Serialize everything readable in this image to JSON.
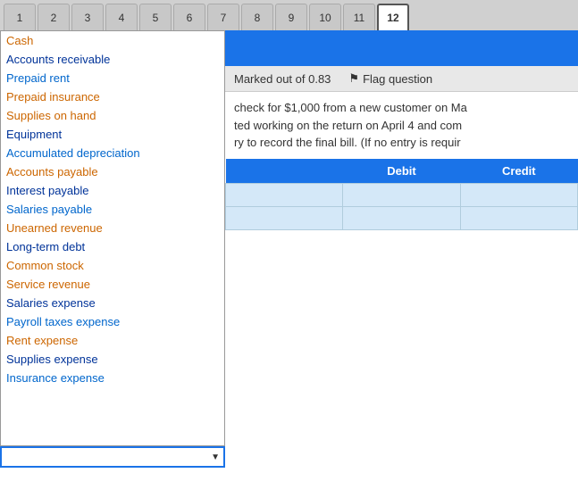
{
  "tabs": [
    {
      "label": "1"
    },
    {
      "label": "2"
    },
    {
      "label": "3"
    },
    {
      "label": "4"
    },
    {
      "label": "5"
    },
    {
      "label": "6"
    },
    {
      "label": "7"
    },
    {
      "label": "8"
    },
    {
      "label": "9"
    },
    {
      "label": "10"
    },
    {
      "label": "11"
    },
    {
      "label": "12"
    }
  ],
  "active_tab": "12",
  "dropdown": {
    "items": [
      {
        "label": "Cash",
        "color": "orange",
        "selected": false
      },
      {
        "label": "Accounts receivable",
        "color": "blue-dark",
        "selected": false
      },
      {
        "label": "Prepaid rent",
        "color": "blue",
        "selected": false
      },
      {
        "label": "Prepaid insurance",
        "color": "orange",
        "selected": false
      },
      {
        "label": "Supplies on hand",
        "color": "orange",
        "selected": false
      },
      {
        "label": "Equipment",
        "color": "blue-dark",
        "selected": false
      },
      {
        "label": "Accumulated depreciation",
        "color": "blue",
        "selected": false
      },
      {
        "label": "Accounts payable",
        "color": "orange",
        "selected": false
      },
      {
        "label": "Interest payable",
        "color": "blue-dark",
        "selected": false
      },
      {
        "label": "Salaries payable",
        "color": "blue",
        "selected": false
      },
      {
        "label": "Unearned revenue",
        "color": "orange",
        "selected": false
      },
      {
        "label": "Long-term debt",
        "color": "blue-dark",
        "selected": false
      },
      {
        "label": "Common stock",
        "color": "orange",
        "selected": false
      },
      {
        "label": "Service revenue",
        "color": "orange",
        "selected": false
      },
      {
        "label": "Salaries expense",
        "color": "blue-dark",
        "selected": false
      },
      {
        "label": "Payroll taxes expense",
        "color": "blue",
        "selected": false
      },
      {
        "label": "Rent expense",
        "color": "orange",
        "selected": false
      },
      {
        "label": "Supplies expense",
        "color": "blue-dark",
        "selected": false
      },
      {
        "label": "Insurance expense",
        "color": "blue",
        "selected": false
      }
    ],
    "second_select_placeholder": ""
  },
  "marked_section": {
    "marked_out_of": "Marked out of 0.83",
    "flag_label": "Flag question"
  },
  "question_text": [
    "check for $1,000 from a new customer on Ma",
    "ted working on the return on April 4 and com",
    "ry to record the final bill.  (If no entry is requir"
  ],
  "table": {
    "headers": [
      "",
      "Debit",
      "Credit"
    ],
    "rows": [
      [
        "",
        "",
        ""
      ],
      [
        "",
        "",
        ""
      ]
    ]
  }
}
